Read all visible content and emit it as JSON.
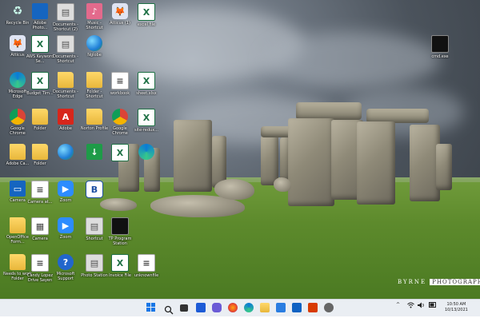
{
  "desktop": {
    "icons": [
      {
        "label": "Recycle Bin",
        "icon": "recycle-icon"
      },
      {
        "label": "Adobe Photo...",
        "icon": "adobe-icon"
      },
      {
        "label": "Documents - Shortcut (2)",
        "icon": "shortcut-icon"
      },
      {
        "label": "Music - Shortcut",
        "icon": "music-icon"
      },
      {
        "label": "Atticus (1)",
        "icon": "fox-icon"
      },
      {
        "label": "excel file",
        "icon": "excel-icon"
      },
      {
        "label": "Atticus",
        "icon": "fox-icon"
      },
      {
        "label": "AWS Keyword Se...",
        "icon": "excel-icon"
      },
      {
        "label": "Documents - Shortcut",
        "icon": "shortcut-icon"
      },
      {
        "label": "Nglobe",
        "icon": "globe-icon"
      },
      {
        "label": "Microsoft Edge",
        "icon": "edge-icon"
      },
      {
        "label": "Budget Tim...",
        "icon": "excel-icon"
      },
      {
        "label": "Documents - Shortcut",
        "icon": "folder-icon"
      },
      {
        "label": "Folder - Shortcut",
        "icon": "folder-icon"
      },
      {
        "label": "workbook",
        "icon": "doc-icon"
      },
      {
        "label": "sheet.xlsx",
        "icon": "excel-icon"
      },
      {
        "label": "Google Chrome",
        "icon": "chrome-icon"
      },
      {
        "label": "Folder",
        "icon": "folder-icon"
      },
      {
        "label": "Adobe",
        "icon": "pdf-icon"
      },
      {
        "label": "Norton Profile",
        "icon": "folder-icon"
      },
      {
        "label": "Google Chrome",
        "icon": "chrome-icon"
      },
      {
        "label": "site-redux...",
        "icon": "excel-icon"
      },
      {
        "label": "Adobe Ca...",
        "icon": "folder-icon"
      },
      {
        "label": "Folder",
        "icon": "folder-icon"
      },
      {
        "label": "Camera",
        "icon": "blue-icon"
      },
      {
        "label": "Camera at...",
        "icon": "doc-icon"
      },
      {
        "label": "Zoom",
        "icon": "zoom-icon"
      },
      {
        "label": "B",
        "icon": "b-icon"
      },
      {
        "label": "OpenOffice Form...",
        "icon": "folder-icon"
      },
      {
        "label": "Camera",
        "icon": "doc-icon"
      },
      {
        "label": "Zoom",
        "icon": "zoom-icon"
      },
      {
        "label": "Shortcut",
        "icon": "shortcut-icon"
      },
      {
        "label": "TP Program Station",
        "icon": "dark-icon"
      },
      {
        "label": "Needs to work Folder",
        "icon": "folder-icon"
      },
      {
        "label": "Candy Lopez Drive Sayen",
        "icon": "doc-icon"
      },
      {
        "label": "Microsoft Support",
        "icon": "help-icon"
      },
      {
        "label": "Photo Station",
        "icon": "shortcut-icon"
      },
      {
        "label": "Invoice File",
        "icon": "excel-icon"
      },
      {
        "label": "unknownfile",
        "icon": "doc-icon"
      },
      {
        "label": "cmd.exe",
        "icon": "dark-icon"
      }
    ],
    "watermark": {
      "name": "BYRNE",
      "box": "PHOTOGRAPHY"
    }
  },
  "taskbar": {
    "apps": [
      "windows-start",
      "search",
      "task-view",
      "widgets",
      "chat",
      "firefox",
      "edge",
      "explorer",
      "store",
      "mail",
      "office",
      "settings"
    ],
    "tray": {
      "chevron": "^",
      "wifi": "wifi-icon",
      "volume": "volume-icon"
    },
    "time": "10:50 AM",
    "date": "10/13/2021"
  }
}
